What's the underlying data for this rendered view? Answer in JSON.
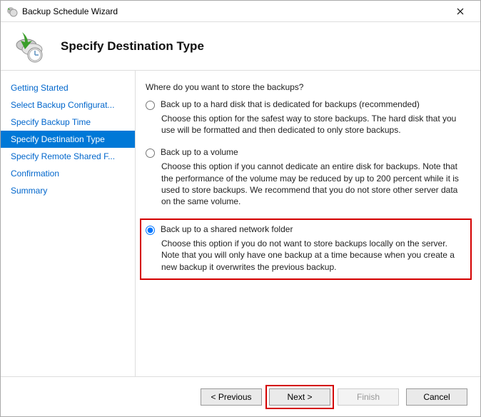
{
  "titlebar": {
    "title": "Backup Schedule Wizard"
  },
  "header": {
    "title": "Specify Destination Type"
  },
  "sidebar": {
    "items": [
      {
        "label": "Getting Started"
      },
      {
        "label": "Select Backup Configurat..."
      },
      {
        "label": "Specify Backup Time"
      },
      {
        "label": "Specify Destination Type"
      },
      {
        "label": "Specify Remote Shared F..."
      },
      {
        "label": "Confirmation"
      },
      {
        "label": "Summary"
      }
    ],
    "selected_index": 3
  },
  "content": {
    "question": "Where do you want to store the backups?",
    "options": [
      {
        "label": "Back up to a hard disk that is dedicated for backups (recommended)",
        "description": "Choose this option for the safest way to store backups. The hard disk that you use will be formatted and then dedicated to only store backups.",
        "selected": false
      },
      {
        "label": "Back up to a volume",
        "description": "Choose this option if you cannot dedicate an entire disk for backups. Note that the performance of the volume may be reduced by up to 200 percent while it is used to store backups. We recommend that you do not store other server data on the same volume.",
        "selected": false
      },
      {
        "label": "Back up to a shared network folder",
        "description": "Choose this option if you do not want to store backups locally on the server. Note that you will only have one backup at a time because when you create a new backup it overwrites the previous backup.",
        "selected": true,
        "highlighted": true
      }
    ]
  },
  "footer": {
    "previous": "< Previous",
    "next": "Next >",
    "finish": "Finish",
    "cancel": "Cancel"
  }
}
